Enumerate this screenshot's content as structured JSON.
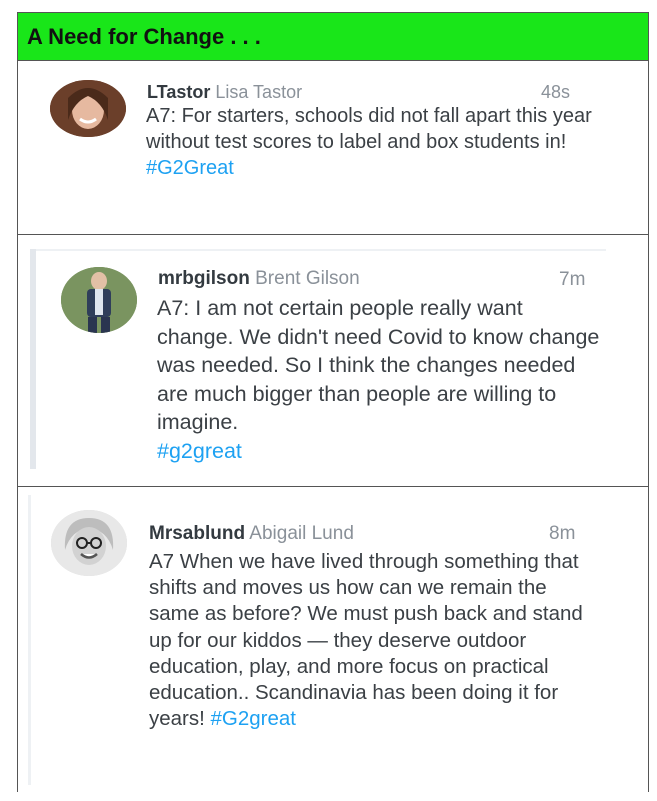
{
  "header": {
    "title": "A Need for Change . . ."
  },
  "tweets": [
    {
      "handle": "LTastor",
      "display_name": "Lisa Tastor",
      "time": "48s",
      "text": "A7: For starters, schools did not fall apart this year without test scores to label and box students in!",
      "hashtag": "#G2Great",
      "avatar_icon": "user-photo-icon"
    },
    {
      "handle": "mrbgilson",
      "display_name": "Brent Gilson",
      "time": "7m",
      "text": "A7: I am not certain people really want change. We didn't need Covid to know change was needed. So I think the changes needed are much bigger than people are willing to imagine.",
      "hashtag": "#g2great",
      "avatar_icon": "user-photo-icon"
    },
    {
      "handle": "Mrsablund",
      "display_name": "Abigail Lund",
      "time": "8m",
      "text": "A7 When we have lived through something that shifts and moves us how can we remain the same as before? We must push back and stand up for our kiddos — they deserve outdoor education, play, and more focus on practical education.. Scandinavia has been doing it for years!",
      "hashtag": "#G2great",
      "avatar_icon": "user-photo-icon"
    }
  ],
  "colors": {
    "header_bg": "#19e619",
    "hashtag": "#1da1f2",
    "muted": "#8a9199",
    "text": "#3b4045"
  }
}
